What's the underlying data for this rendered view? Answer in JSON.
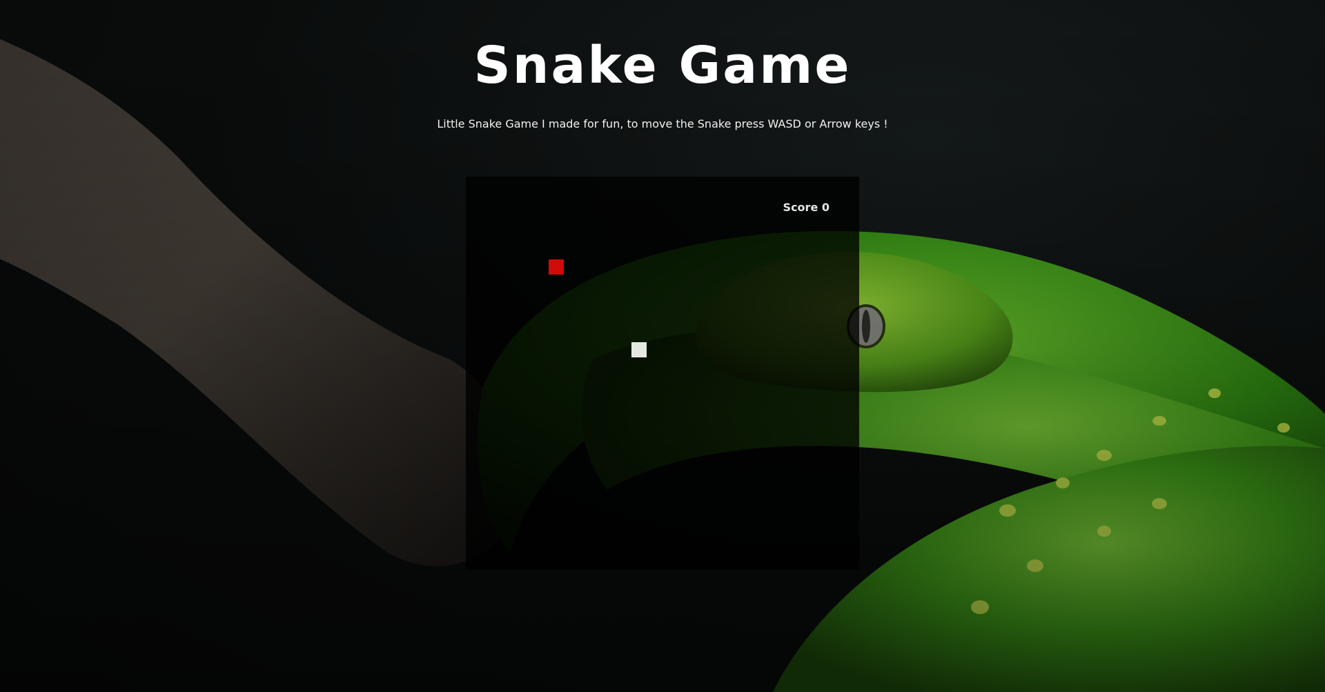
{
  "header": {
    "title": "Snake Game",
    "subtitle": "Little Snake Game I made for fun, to move the Snake press WASD or Arrow keys !"
  },
  "game": {
    "score_label": "Score 0",
    "food_color": "#d30a0a",
    "snake_color": "#e4eadf"
  },
  "background": {
    "subject": "green-python-on-branch",
    "accent_color": "#3fa21b"
  }
}
